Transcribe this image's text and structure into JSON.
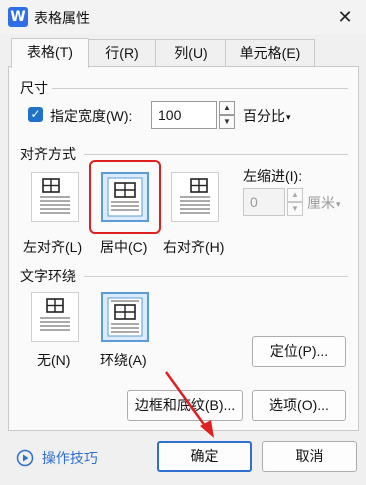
{
  "window": {
    "title": "表格属性",
    "close_glyph": "✕"
  },
  "tabs": [
    {
      "label": "表格(T)",
      "active": true
    },
    {
      "label": "行(R)",
      "active": false
    },
    {
      "label": "列(U)",
      "active": false
    },
    {
      "label": "单元格(E)",
      "active": false
    }
  ],
  "size_section": {
    "heading": "尺寸",
    "width_checkbox_label": "指定宽度(W):",
    "width_checked": true,
    "width_value": "100",
    "unit_value": "百分比"
  },
  "alignment_section": {
    "heading": "对齐方式",
    "options": [
      {
        "label": "左对齐(L)",
        "selected": false
      },
      {
        "label": "居中(C)",
        "selected": true
      },
      {
        "label": "右对齐(H)",
        "selected": false
      }
    ],
    "indent_label": "左缩进(I):",
    "indent_value": "0",
    "indent_unit": "厘米"
  },
  "wrap_section": {
    "heading": "文字环绕",
    "options": [
      {
        "label": "无(N)",
        "selected": false
      },
      {
        "label": "环绕(A)",
        "selected": true
      }
    ],
    "position_button": "定位(P)..."
  },
  "bottom_buttons": {
    "borders": "边框和底纹(B)...",
    "options": "选项(O)..."
  },
  "footer": {
    "tips_label": "操作技巧",
    "ok": "确定",
    "cancel": "取消"
  },
  "colors": {
    "accent": "#1f72c8",
    "highlight_red": "#e02020"
  }
}
